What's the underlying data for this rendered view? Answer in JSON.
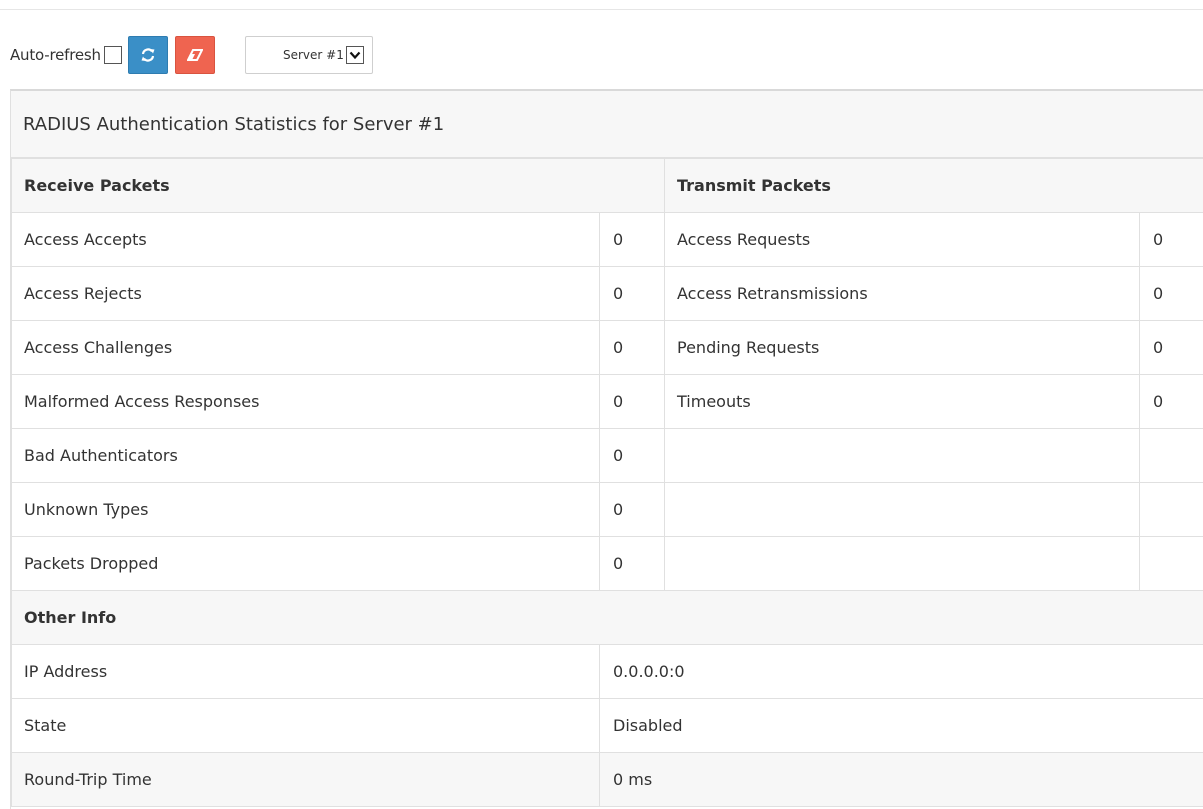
{
  "toolbar": {
    "auto_refresh_label": "Auto-refresh",
    "refresh_icon": "refresh-icon",
    "clear_icon": "eraser-icon",
    "server_select_value": "Server #1"
  },
  "panel": {
    "title": "RADIUS Authentication Statistics for Server #1"
  },
  "receive": {
    "header": "Receive Packets",
    "rows": [
      {
        "label": "Access Accepts",
        "value": "0"
      },
      {
        "label": "Access Rejects",
        "value": "0"
      },
      {
        "label": "Access Challenges",
        "value": "0"
      },
      {
        "label": "Malformed Access Responses",
        "value": "0"
      },
      {
        "label": "Bad Authenticators",
        "value": "0"
      },
      {
        "label": "Unknown Types",
        "value": "0"
      },
      {
        "label": "Packets Dropped",
        "value": "0"
      }
    ]
  },
  "transmit": {
    "header": "Transmit Packets",
    "rows": [
      {
        "label": "Access Requests",
        "value": "0"
      },
      {
        "label": "Access Retransmissions",
        "value": "0"
      },
      {
        "label": "Pending Requests",
        "value": "0"
      },
      {
        "label": "Timeouts",
        "value": "0"
      }
    ]
  },
  "other": {
    "header": "Other Info",
    "rows": [
      {
        "label": "IP Address",
        "value": "0.0.0.0:0"
      },
      {
        "label": "State",
        "value": "Disabled"
      },
      {
        "label": "Round-Trip Time",
        "value": "0 ms"
      }
    ]
  },
  "colors": {
    "refresh_button": "#3a8fc7",
    "clear_button": "#ef6450",
    "header_bg": "#f7f7f7",
    "border": "#e0e0e0"
  }
}
